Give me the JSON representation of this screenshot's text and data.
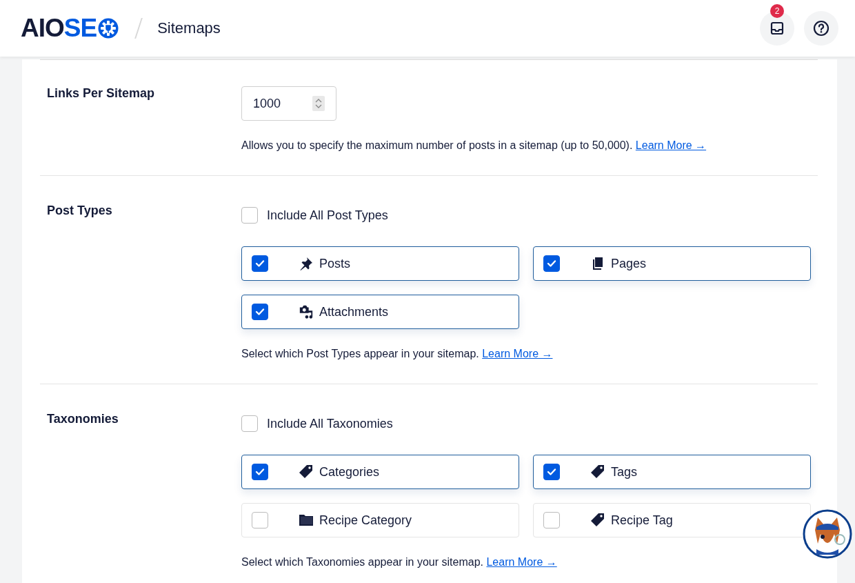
{
  "header": {
    "logo": {
      "dark": "AIO",
      "blue": "SE"
    },
    "page_title": "Sitemaps",
    "notifications": {
      "count": "2"
    }
  },
  "sections": [
    {
      "kind": "number",
      "label": "Links Per Sitemap",
      "value": "1000",
      "description": "Allows you to specify the maximum number of posts in a sitemap (up to 50,000).",
      "link": "Learn More →"
    },
    {
      "kind": "options",
      "label": "Post Types",
      "include_all": {
        "label": "Include All Post Types",
        "checked": false
      },
      "options": [
        {
          "label": "Posts",
          "kind": "pin",
          "checked": true
        },
        {
          "label": "Pages",
          "kind": "pages",
          "checked": true
        },
        {
          "label": "Attachments",
          "kind": "attachments",
          "checked": true
        }
      ],
      "description": "Select which Post Types appear in your sitemap.",
      "link": "Learn More →"
    },
    {
      "kind": "options",
      "label": "Taxonomies",
      "include_all": {
        "label": "Include All Taxonomies",
        "checked": false
      },
      "options": [
        {
          "label": "Categories",
          "kind": "tag",
          "checked": true
        },
        {
          "label": "Tags",
          "kind": "tag",
          "checked": true
        },
        {
          "label": "Recipe Category",
          "kind": "folder",
          "checked": false
        },
        {
          "label": "Recipe Tag",
          "kind": "tag",
          "checked": false
        }
      ],
      "description": "Select which Taxonomies appear in your sitemap.",
      "link": "Learn More →"
    }
  ]
}
